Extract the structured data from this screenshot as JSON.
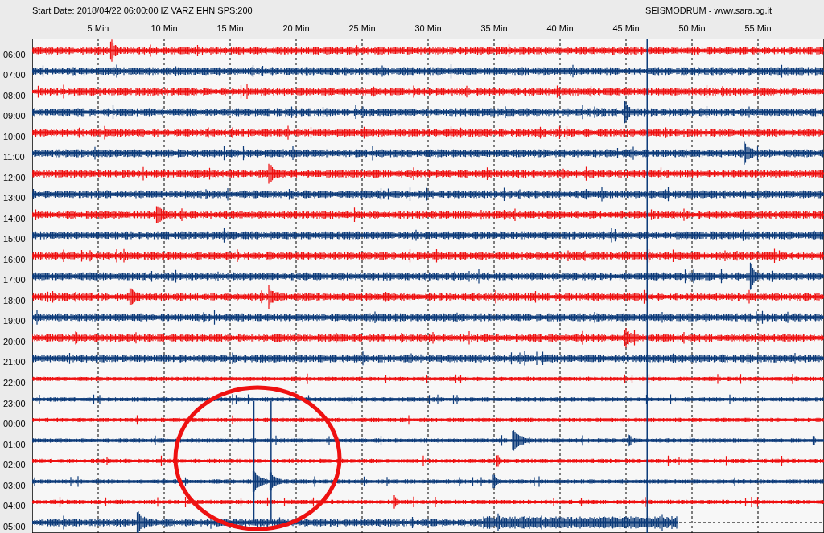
{
  "header": {
    "start_info": "Start Date: 2018/04/22 06:00:00 IZ VARZ EHN SPS:200",
    "credit": "SEISMODRUM - www.sara.pg.it"
  },
  "minute_ticks": [
    "5 Min",
    "10 Min",
    "15 Min",
    "20 Min",
    "25 Min",
    "30 Min",
    "35 Min",
    "40 Min",
    "45 Min",
    "50 Min",
    "55 Min"
  ],
  "rows": [
    {
      "time": "06:00",
      "color": "#ee1111"
    },
    {
      "time": "07:00",
      "color": "#0d3b7a"
    },
    {
      "time": "08:00",
      "color": "#ee1111"
    },
    {
      "time": "09:00",
      "color": "#0d3b7a"
    },
    {
      "time": "10:00",
      "color": "#ee1111"
    },
    {
      "time": "11:00",
      "color": "#0d3b7a"
    },
    {
      "time": "12:00",
      "color": "#ee1111"
    },
    {
      "time": "13:00",
      "color": "#0d3b7a"
    },
    {
      "time": "14:00",
      "color": "#ee1111"
    },
    {
      "time": "15:00",
      "color": "#0d3b7a"
    },
    {
      "time": "16:00",
      "color": "#ee1111"
    },
    {
      "time": "17:00",
      "color": "#0d3b7a"
    },
    {
      "time": "18:00",
      "color": "#ee1111"
    },
    {
      "time": "19:00",
      "color": "#0d3b7a"
    },
    {
      "time": "20:00",
      "color": "#ee1111"
    },
    {
      "time": "21:00",
      "color": "#0d3b7a"
    },
    {
      "time": "22:00",
      "color": "#ee1111"
    },
    {
      "time": "23:00",
      "color": "#0d3b7a"
    },
    {
      "time": "00:00",
      "color": "#ee1111"
    },
    {
      "time": "01:00",
      "color": "#0d3b7a"
    },
    {
      "time": "02:00",
      "color": "#ee1111"
    },
    {
      "time": "03:00",
      "color": "#0d3b7a"
    },
    {
      "time": "04:00",
      "color": "#ee1111"
    },
    {
      "time": "05:00",
      "color": "#0d3b7a",
      "level": 0.815
    }
  ]
}
